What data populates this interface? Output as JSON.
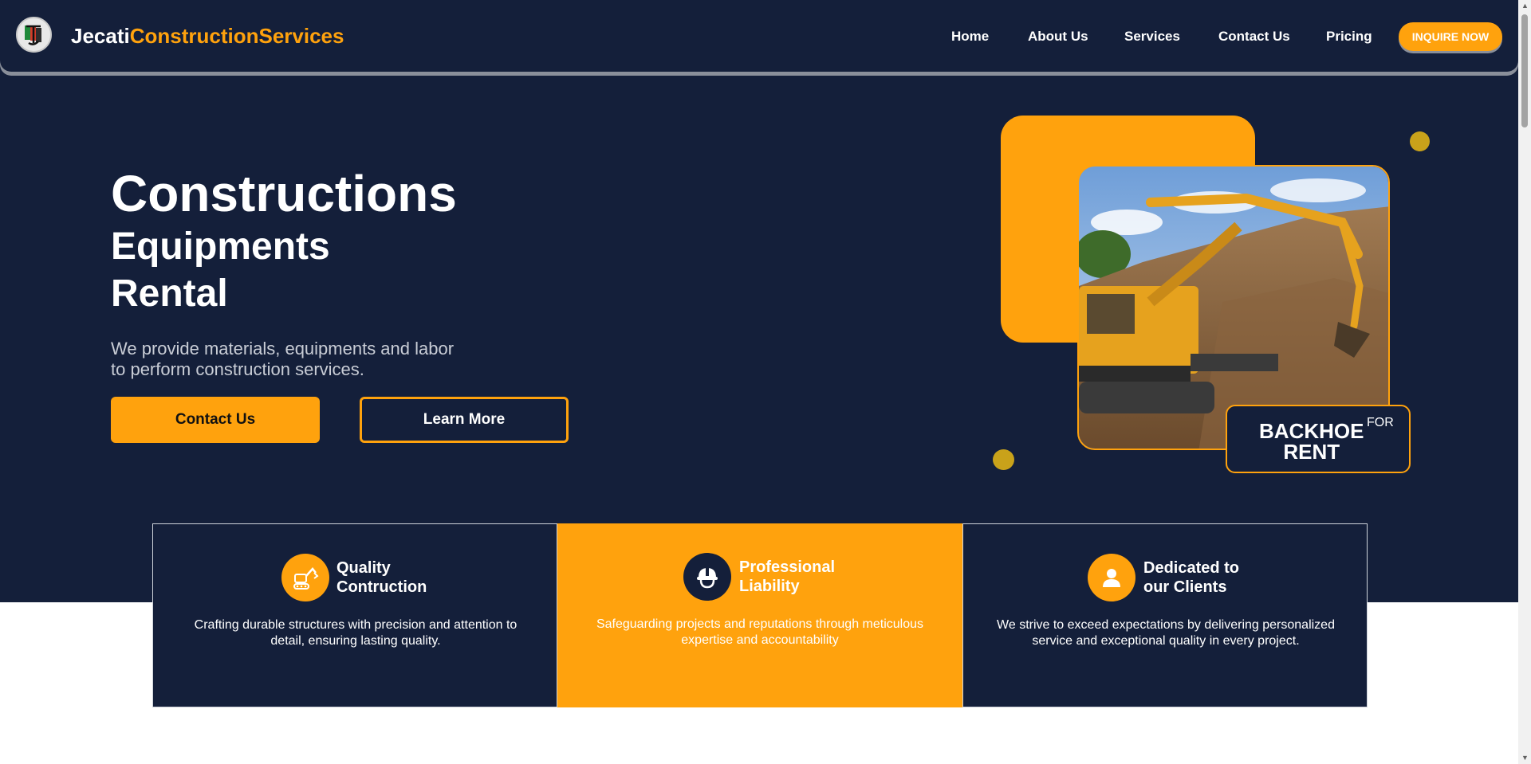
{
  "brand": {
    "name_part1": "Jecati",
    "name_part2": "ConstructionServices",
    "logo_icon": "jcs-logo-icon"
  },
  "nav": {
    "items": [
      {
        "label": "Home"
      },
      {
        "label": "About Us"
      },
      {
        "label": "Services"
      },
      {
        "label": "Contact Us"
      },
      {
        "label": "Pricing"
      }
    ],
    "cta_label": "INQUIRE NOW"
  },
  "hero": {
    "line1": "Constructions",
    "line2": "Equipments",
    "line3": "Rental",
    "subtitle": "We provide materials, equipments and labor to perform construction services.",
    "primary_button": "Contact Us",
    "secondary_button": "Learn More",
    "badge_main_line1": "BACKHOE",
    "badge_main_line2": "RENT",
    "badge_for": "FOR"
  },
  "features": [
    {
      "icon": "excavator-icon",
      "title_line1": "Quality",
      "title_line2": "Contruction",
      "description": "Crafting durable structures with precision and attention to detail, ensuring lasting quality."
    },
    {
      "icon": "hard-hat-icon",
      "title_line1": "Professional",
      "title_line2": "Liability",
      "description": "Safeguarding projects and reputations through meticulous expertise and accountability"
    },
    {
      "icon": "user-icon",
      "title_line1": "Dedicated to",
      "title_line2": "our Clients",
      "description": "We strive to exceed expectations by delivering personalized service and exceptional quality in every project."
    }
  ],
  "colors": {
    "navy": "#141f3a",
    "accent": "#ffa20d",
    "white": "#ffffff"
  }
}
